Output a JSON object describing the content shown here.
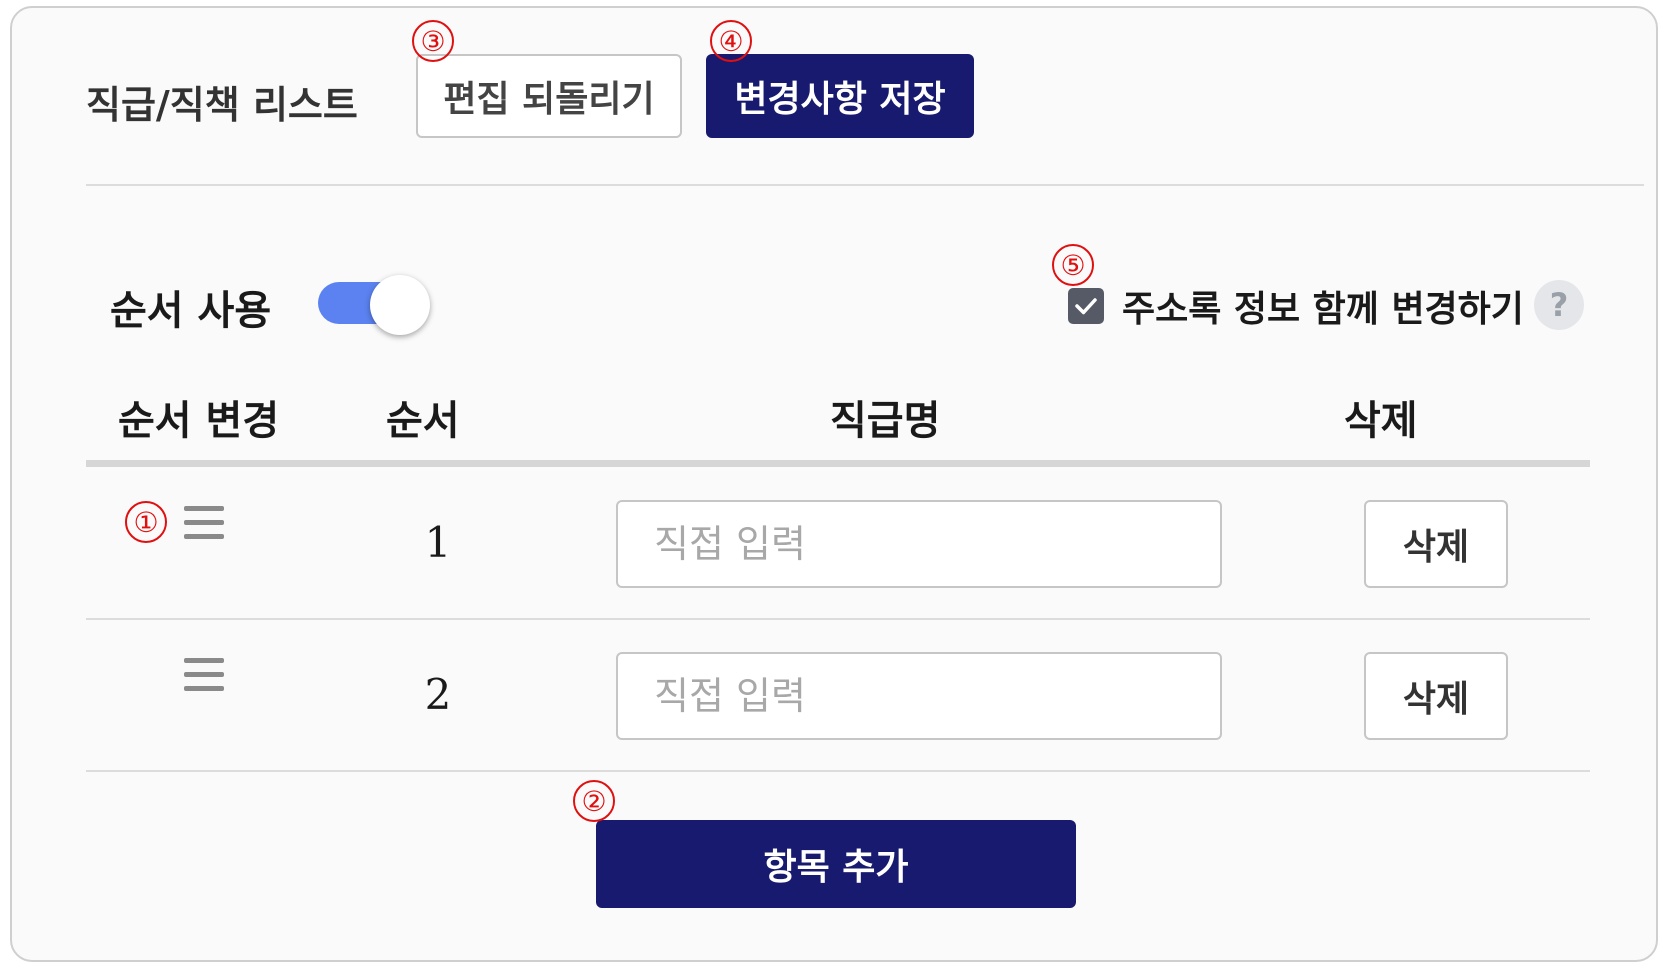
{
  "header": {
    "title": "직급/직책 리스트",
    "revert_label": "편집 되돌리기",
    "save_label": "변경사항 저장"
  },
  "settings": {
    "order_label": "순서 사용",
    "order_enabled": true,
    "sync_label": "주소록 정보 함께 변경하기",
    "sync_checked": true,
    "help_glyph": "?"
  },
  "table": {
    "columns": [
      "순서 변경",
      "순서",
      "직급명",
      "삭제"
    ],
    "rows": [
      {
        "order": "1",
        "name_value": "",
        "name_placeholder": "직접 입력",
        "delete_label": "삭제"
      },
      {
        "order": "2",
        "name_value": "",
        "name_placeholder": "직접 입력",
        "delete_label": "삭제"
      }
    ]
  },
  "add_button_label": "항목 추가",
  "annotations": [
    "①",
    "②",
    "③",
    "④",
    "⑤"
  ],
  "colors": {
    "primary": "#171a6e",
    "toggle_on": "#5b82f0",
    "annotation": "#e01010",
    "checkbox": "#555a66"
  },
  "icons": {
    "drag": "drag-handle-icon",
    "check": "check-icon",
    "help": "help-icon"
  }
}
